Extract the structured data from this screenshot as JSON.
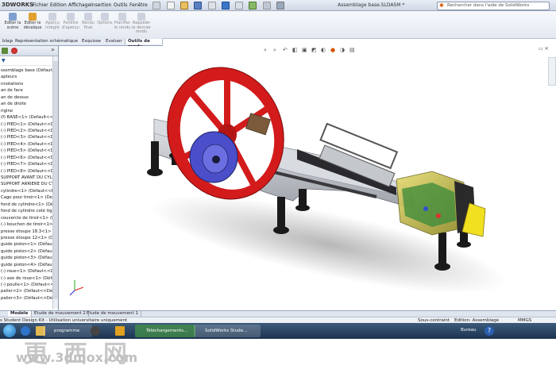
{
  "titlebar": {
    "brand": "3DWORKS",
    "menus": [
      "Fichier",
      "Edition",
      "Affichage",
      "Insertion",
      "Outils",
      "Fenêtre"
    ],
    "document_title": "Assemblage base.SLDASM *",
    "search_placeholder": "Rechercher dans l'aide de SolidWorks"
  },
  "command_manager": {
    "buttons": [
      "Editer la scène",
      "Editer le décalque",
      "Aperçu intégré",
      "Fenêtre d'aperçu",
      "Rendu final",
      "Options",
      "Planifier le rendu",
      "Rappeler le dernier rendu"
    ]
  },
  "tabs": [
    "blage",
    "Représentation schématique",
    "Esquisse",
    "Evaluer",
    "Outils de rendu"
  ],
  "active_tab": "Outils de rendu",
  "tree": {
    "root": "ssemblage base (Défaut<Ét",
    "items": [
      "apteurs",
      "nnotations",
      "an de face",
      "an de dessus",
      "an de droite",
      "rigine",
      "(f) BASE<1> (Default<<D",
      "(-) PIED<1> (Défaut<<Dé",
      "(-) PIED<2> (Défaut<<Dé",
      "(-) PIED<3> (Défaut<<Dé",
      "(-) PIED<4> (Défaut<<Dé",
      "(-) PIED<5> (Défaut<<Dé",
      "(-) PIED<6> (Défaut<<Dé",
      "(-) PIED<7> (Défaut<<Dé",
      "(-) PIED<8> (Défaut<<Dé",
      "SUPPORT AVANT DU CYL",
      "SUPPORT ARRIERE DU CY",
      "cylindre<1> (Défaut<<Dé",
      "Cage pour tiroir<1> (Defa",
      "fond de cylindre<1> (Défa",
      "fond de cylindre coté tig",
      "couvercle de tiroir<1> (De",
      "(-) bouchon de tiroir<1>",
      "presse étoupe 18.3<1> (D",
      "presse étoupe 12<1> (Déf",
      "guide piston<1> (Défaut<",
      "guide piston<2> (Défaut<",
      "guide piston<3> (Défaut<",
      "guide piston<4> (Défaut<",
      "(-) roue<1> (Défaut<<Déf",
      "(-) axe de roue<1> (Défau",
      "(-) poulie<1> (Défaut<<D",
      "palier<2> (Défaut<<Défau",
      "palier<3> (Défaut<<Défau"
    ]
  },
  "bottom_tabs": [
    "Modèle",
    "Etude de mouvement 2",
    "Etude de mouvement 1"
  ],
  "status": {
    "left": "s Student Design Kit - Utilisation universitaire uniquement",
    "constraint": "Sous-contraint",
    "mode": "Edition: Assemblage",
    "units": "MMGS"
  },
  "taskbar": {
    "items": [
      "programme desi...",
      "Téléchargements...",
      "SolidWorks Stude..."
    ],
    "tray_label": "Bureau"
  },
  "watermark": {
    "chars": "更西网",
    "url": "www.3dmox.com"
  },
  "colors": {
    "wheel": "#d31b1b",
    "pulley": "#4a4ec8",
    "frame": "#b9bcc4",
    "cylinder": "#c8c040",
    "yellow_part": "#f0e020",
    "feet": "#1a1a1a"
  }
}
